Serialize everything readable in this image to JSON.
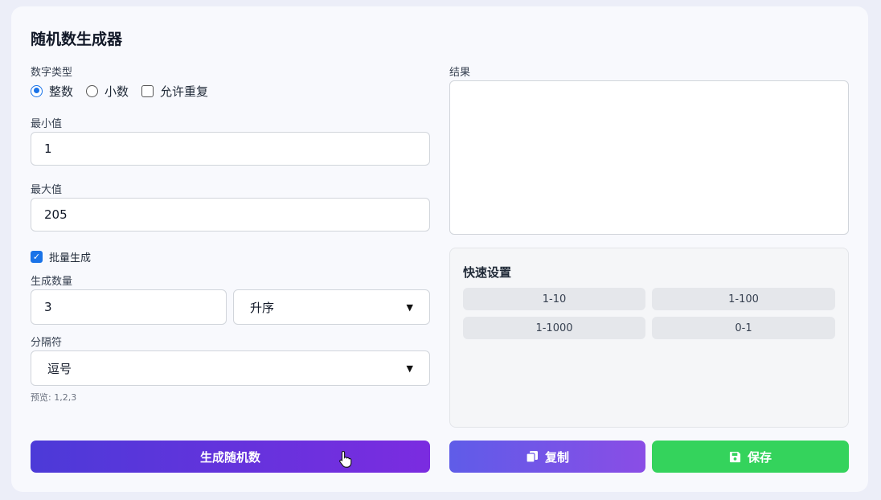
{
  "title": "随机数生成器",
  "number_type": {
    "label": "数字类型",
    "options": [
      {
        "label": "整数",
        "selected": true
      },
      {
        "label": "小数",
        "selected": false
      }
    ],
    "allow_repeat": {
      "label": "允许重复",
      "checked": false
    }
  },
  "min": {
    "label": "最小值",
    "value": "1"
  },
  "max": {
    "label": "最大值",
    "value": "205"
  },
  "batch": {
    "label": "批量生成",
    "checked": true
  },
  "count": {
    "label": "生成数量",
    "value": "3"
  },
  "order": {
    "selected": "升序"
  },
  "separator": {
    "label": "分隔符",
    "selected": "逗号",
    "preview": "预览: 1,2,3"
  },
  "result": {
    "label": "结果",
    "value": ""
  },
  "quick": {
    "title": "快速设置",
    "buttons": [
      "1-10",
      "1-100",
      "1-1000",
      "0-1"
    ]
  },
  "actions": {
    "generate": "生成随机数",
    "copy": "复制",
    "save": "保存"
  },
  "colors": {
    "accent": "#1a73e8",
    "generate": "#5b34dc",
    "copy": "#7155e7",
    "save": "#34d35c"
  }
}
